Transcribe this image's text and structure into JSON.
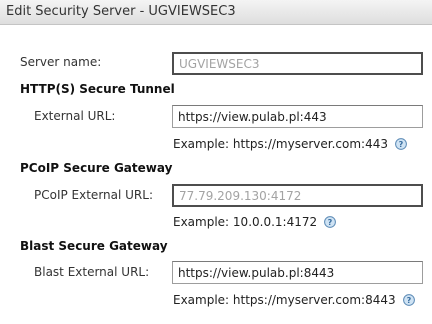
{
  "dialog": {
    "title": "Edit Security Server - UGVIEWSEC3"
  },
  "server_name": {
    "label": "Server name:",
    "value": "UGVIEWSEC3"
  },
  "https_tunnel": {
    "heading": "HTTP(S) Secure Tunnel",
    "label": "External URL:",
    "value": "https://view.pulab.pl:443",
    "example": "Example: https://myserver.com:443"
  },
  "pcoip_gateway": {
    "heading": "PCoIP Secure Gateway",
    "label": "PCoIP External URL:",
    "value": "77.79.209.130:4172",
    "example": "Example: 10.0.0.1:4172"
  },
  "blast_gateway": {
    "heading": "Blast Secure Gateway",
    "label": "Blast External URL:",
    "value": "https://view.pulab.pl:8443",
    "example": "Example: https://myserver.com:8443"
  },
  "icons": {
    "help": "help-question-icon"
  },
  "colors": {
    "help_icon_fill": "#cfe3f4",
    "help_icon_stroke": "#5b8ab5",
    "readonly_text": "#a3a3a3"
  }
}
